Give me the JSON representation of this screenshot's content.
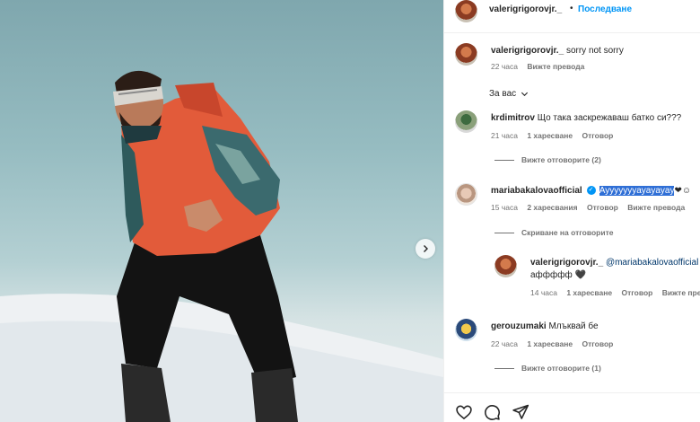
{
  "header": {
    "username": "valerigrigorovjr._",
    "dot": "•",
    "follow_label": "Последване"
  },
  "caption": {
    "username": "valerigrigorovjr._",
    "text": "sorry not sorry",
    "time": "22 часа",
    "translate": "Вижте превода"
  },
  "section_label": "За вас",
  "comments": [
    {
      "username": "krdimitrov",
      "text": "Що така заскрежаваш батко си???",
      "time": "21 часа",
      "likes": "1 харесване",
      "reply": "Отговор",
      "view_replies": "Вижте отговорите (2)"
    },
    {
      "username": "mariabakalovaofficial",
      "text_highlight": "Ayyyyyyyayayayay",
      "text_suffix": "❤☺",
      "time": "15 часа",
      "likes": "2 харесвания",
      "reply": "Отговор",
      "translate": "Вижте превода",
      "hide_replies": "Скриване на отговорите",
      "replies": [
        {
          "username": "valerigrigorovjr._",
          "mention": "@mariabakalovaofficial",
          "text": "аффффф 🖤",
          "time": "14 часа",
          "likes": "1 харесване",
          "reply": "Отговор",
          "translate": "Вижте превода"
        }
      ]
    },
    {
      "username": "gerouzumaki",
      "text": "Млъквай бе",
      "time": "22 часа",
      "likes": "1 харесване",
      "reply": "Отговор",
      "view_replies": "Вижте отговорите (1)"
    }
  ],
  "icons": [
    "heart-icon",
    "comment-icon",
    "share-icon",
    "chevron-right-icon",
    "chevron-down-icon",
    "verified-icon"
  ],
  "colors": {
    "accent": "#0095f6",
    "highlight": "#2f6fd6",
    "jacket": "#e25b3a"
  }
}
